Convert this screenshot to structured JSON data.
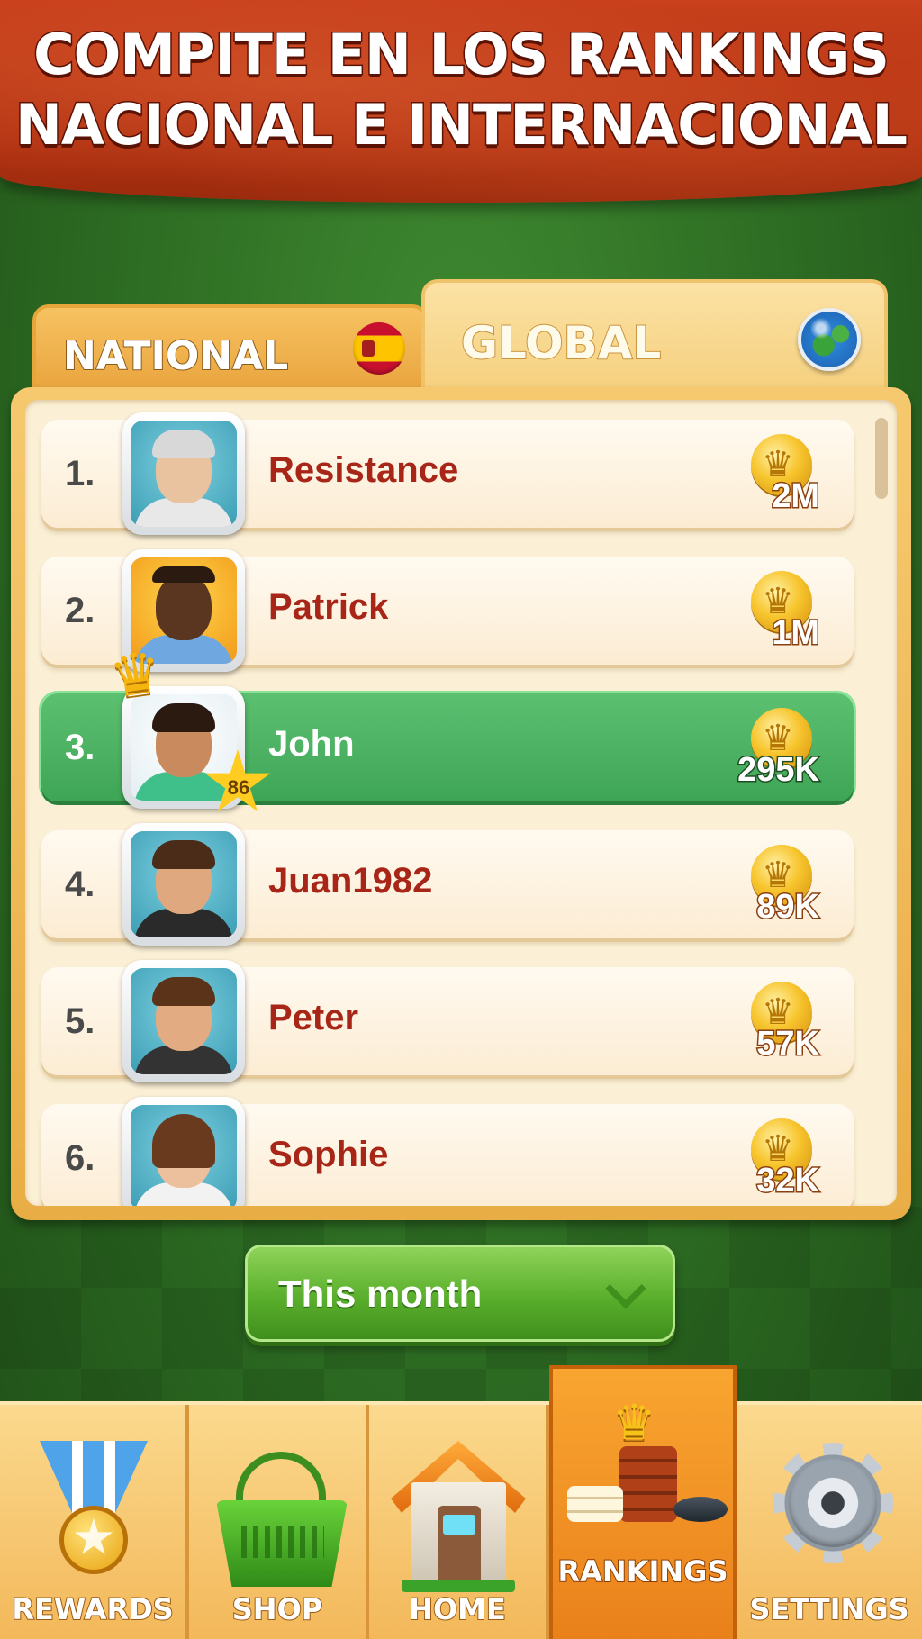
{
  "banner": {
    "line1": "COMPITE EN LOS RANKINGS",
    "line2": "NACIONAL E INTERNACIONAL"
  },
  "tabs": [
    {
      "label": "NATIONAL",
      "icon": "spain-flag-icon",
      "selected": false
    },
    {
      "label": "GLOBAL",
      "icon": "globe-icon",
      "selected": true
    }
  ],
  "leaderboard": {
    "rows": [
      {
        "rank": "1.",
        "name": "Resistance",
        "score": "2M",
        "avatar": "avatar-old-man",
        "current_user": false
      },
      {
        "rank": "2.",
        "name": "Patrick",
        "score": "1M",
        "avatar": "avatar-bearded-man",
        "current_user": false
      },
      {
        "rank": "3.",
        "name": "John",
        "score": "295K",
        "avatar": "avatar-smiling-man",
        "current_user": true,
        "level": "86"
      },
      {
        "rank": "4.",
        "name": "Juan1982",
        "score": "89K",
        "avatar": "avatar-young-man",
        "current_user": false
      },
      {
        "rank": "5.",
        "name": "Peter",
        "score": "57K",
        "avatar": "avatar-man",
        "current_user": false
      },
      {
        "rank": "6.",
        "name": "Sophie",
        "score": "32K",
        "avatar": "avatar-woman",
        "current_user": false
      }
    ]
  },
  "period_selector": {
    "label": "This month"
  },
  "nav": {
    "items": [
      {
        "label": "REWARDS",
        "icon": "medal-icon",
        "active": false
      },
      {
        "label": "SHOP",
        "icon": "basket-icon",
        "active": false
      },
      {
        "label": "HOME",
        "icon": "house-icon",
        "active": false
      },
      {
        "label": "RANKINGS",
        "icon": "chips-crown-icon",
        "active": true
      },
      {
        "label": "SETTINGS",
        "icon": "gear-icon",
        "active": false
      }
    ]
  },
  "colors": {
    "banner": "#b23212",
    "highlight_row": "#4cb364",
    "name_text": "#a82618",
    "nav_active": "#f29424"
  }
}
